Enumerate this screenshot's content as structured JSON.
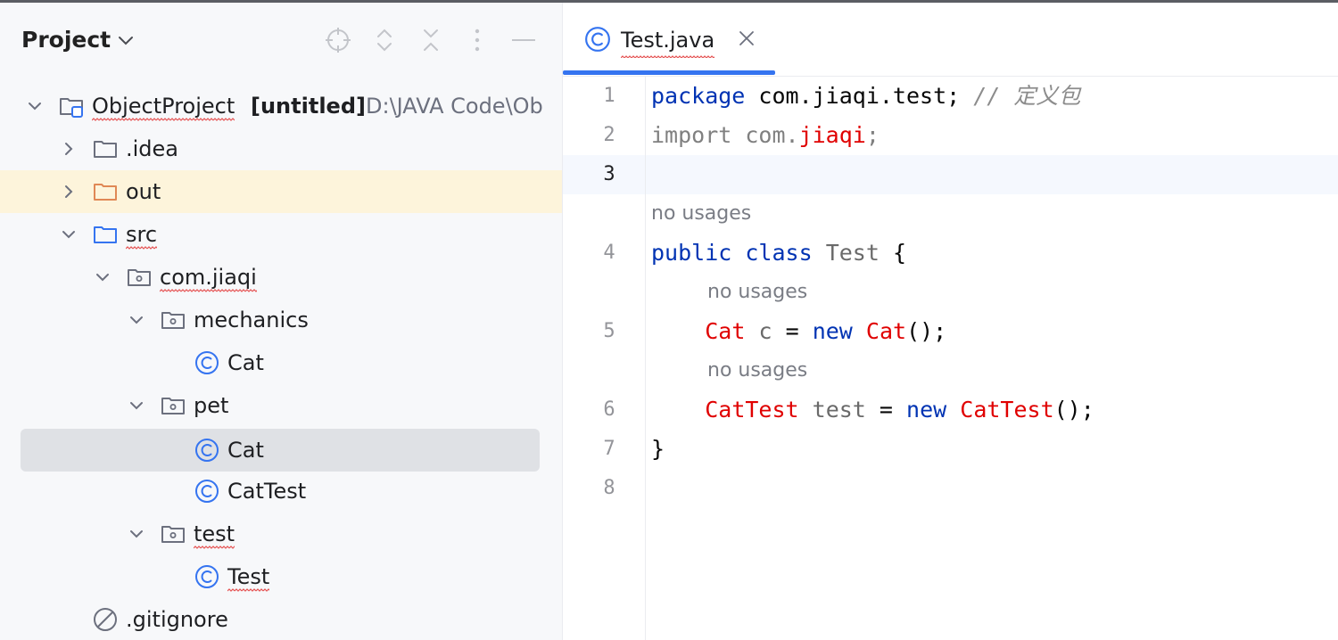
{
  "project_panel": {
    "title": "Project"
  },
  "tree": [
    {
      "label": "ObjectProject",
      "suffix": "[untitled]",
      "path": "D:\\JAVA Code\\Ob"
    },
    {
      "label": ".idea"
    },
    {
      "label": "out"
    },
    {
      "label": "src"
    },
    {
      "label": "com.jiaqi"
    },
    {
      "label": "mechanics"
    },
    {
      "label": "Cat"
    },
    {
      "label": "pet"
    },
    {
      "label": "Cat"
    },
    {
      "label": "CatTest"
    },
    {
      "label": "test"
    },
    {
      "label": "Test"
    },
    {
      "label": ".gitignore"
    }
  ],
  "editor": {
    "tab_label": "Test.java",
    "line_numbers": [
      "1",
      "2",
      "3",
      "4",
      "5",
      "6",
      "7",
      "8"
    ],
    "hints": [
      "no usages",
      "no usages",
      "no usages"
    ],
    "code": {
      "l1": {
        "kw": "package",
        "rest": " com.jiaqi.test; ",
        "comment": "// 定义包"
      },
      "l2": {
        "kw": "import",
        "pkg": " com.",
        "name": "jiaqi",
        "end": ";"
      },
      "l4": {
        "kw1": "public",
        "kw2": "class",
        "cls": "Test",
        "brace": "{"
      },
      "l5": {
        "type": "Cat",
        "var": "c",
        "op": "=",
        "kw": "new",
        "ctor": "Cat",
        "end": "();"
      },
      "l6": {
        "type": "CatTest",
        "var": "test",
        "op": "=",
        "kw": "new",
        "ctor": "CatTest",
        "end": "();"
      },
      "l7": {
        "brace": "}"
      }
    }
  },
  "colors": {
    "accent": "#3574f0",
    "keyword": "#0033b3",
    "error_red": "#e00000",
    "selection": "#dfe1e5",
    "highlight_excluded": "#fdf4db"
  },
  "icons": {
    "header": [
      "locate-icon",
      "expand-collapse-icon",
      "collapse-all-icon",
      "more-options-icon",
      "minimize-icon"
    ]
  }
}
